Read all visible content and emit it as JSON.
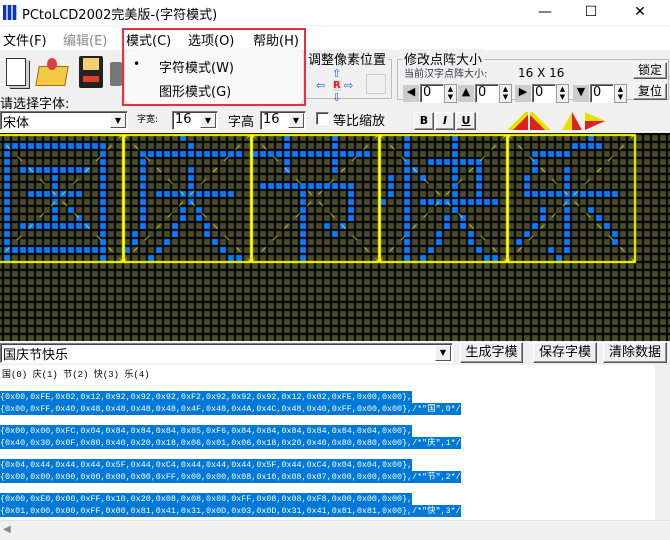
{
  "window": {
    "title": "PCtoLCD2002完美版-(字符模式)",
    "minimize": "—",
    "maximize": "☐",
    "close": "✕"
  },
  "menu": {
    "items": [
      {
        "label": "文件(F)",
        "enabled": true
      },
      {
        "label": "编辑(E)",
        "enabled": false
      },
      {
        "label": "模式(C)",
        "enabled": true
      },
      {
        "label": "选项(O)",
        "enabled": true
      },
      {
        "label": "帮助(H)",
        "enabled": true
      }
    ],
    "dropdown": [
      {
        "label": "字符模式(W)",
        "checked": true,
        "bullet": "•"
      },
      {
        "label": "图形模式(G)",
        "checked": false
      }
    ]
  },
  "toolbar": {
    "icons": [
      "new-file-icon",
      "open-folder-icon",
      "save-floppy-icon",
      "settings-icon"
    ]
  },
  "pixel_adjust": {
    "title": "调整像素位置",
    "center": "R"
  },
  "matrix_size": {
    "title": "修改点阵大小",
    "current_label": "当前汉字点阵大小:",
    "current_value": "16 X 16",
    "lock": "锁定",
    "reset": "复位",
    "spinners": [
      "0",
      "0",
      "0",
      "0"
    ],
    "spin_up": "▲",
    "spin_down": "▼"
  },
  "font": {
    "label": "请选择字体:",
    "value": "宋体",
    "width_label": "字宽:",
    "width": "16",
    "height_label": "字高",
    "height": "16",
    "proportional": "等比缩放",
    "proportional_checked": false,
    "bold": "B",
    "italic": "I",
    "underline": "U"
  },
  "grid": {
    "cell_color": "#4a4b2b",
    "pixel_color": "#0a7cff",
    "frame_color": "#ffff00",
    "extra_glyph_乐": [
      "00",
      "00",
      "00",
      "20",
      "E0",
      "10",
      "9C",
      "08",
      "84",
      "06",
      "84",
      "40",
      "84",
      "80",
      "F4",
      "7F",
      "82",
      "00",
      "82",
      "00",
      "83",
      "02",
      "82",
      "04",
      "80",
      "08",
      "80",
      "30",
      "00",
      "00",
      "00",
      "00"
    ]
  },
  "input": {
    "text": "国庆节快乐",
    "generate": "生成字模",
    "save": "保存字模",
    "clear": "清除数据"
  },
  "output": {
    "index_line": "国(0) 庆(1) 节(2) 快(3) 乐(4)",
    "entries": [
      {
        "line1": "{0x00,0xFE,0x02,0x12,0x92,0x92,0x92,0xF2,0x92,0x92,0x92,0x12,0x02,0xFE,0x00,0x00},",
        "line2": "{0x00,0xFF,0x40,0x48,0x48,0x48,0x48,0x4F,0x48,0x4A,0x4C,0x48,0x40,0xFF,0x00,0x00},/*\"国\",0*/"
      },
      {
        "line1": "{0x00,0x00,0xFC,0x04,0x84,0x84,0x84,0x85,0xF6,0x84,0x84,0x84,0x84,0x84,0x04,0x00},",
        "line2": "{0x40,0x30,0x0F,0x80,0x40,0x20,0x18,0x06,0x01,0x06,0x18,0x20,0x40,0x80,0x80,0x00},/*\"庆\",1*/"
      },
      {
        "line1": "{0x04,0x44,0x44,0x44,0x5F,0x44,0xC4,0x44,0x44,0x44,0x5F,0x44,0xC4,0x04,0x04,0x00},",
        "line2": "{0x00,0x00,0x00,0x00,0x00,0x00,0xFF,0x00,0x00,0x08,0x10,0x08,0x07,0x00,0x00,0x00},/*\"节\",2*/"
      },
      {
        "line1": "{0x00,0xE0,0x00,0xFF,0x10,0x20,0x08,0x08,0x08,0xFF,0x08,0x08,0xF8,0x00,0x00,0x00},",
        "line2": "{0x01,0x00,0x00,0xFF,0x00,0x81,0x41,0x31,0x0D,0x03,0x0D,0x31,0x41,0x81,0x81,0x00},/*\"快\",3*/"
      }
    ]
  },
  "scroll": {
    "left_arrow": "◀"
  }
}
